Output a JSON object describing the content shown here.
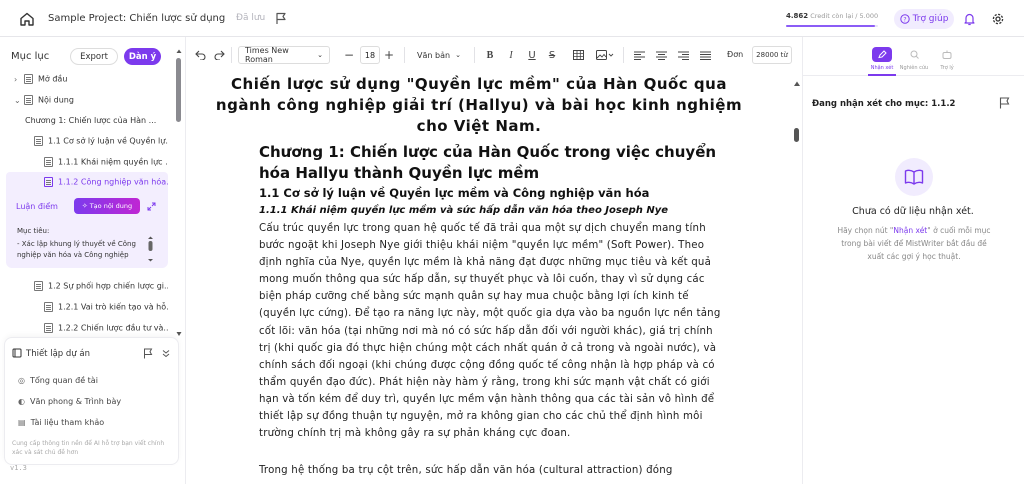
{
  "header": {
    "project_title": "Sample Project: Chiến lược sử dụng \"Qu...",
    "saved_status": "Đã lưu",
    "credit_value": "4.862",
    "credit_label": "Credit còn lại",
    "credit_total": "5.000",
    "credit_fraction": 0.9724,
    "help_label": "Trợ giúp"
  },
  "sidebar": {
    "title": "Mục lục",
    "export_label": "Export",
    "outline_label": "Dàn ý",
    "items": [
      {
        "label": "Mở đầu",
        "expanded": false
      },
      {
        "label": "Nội dung",
        "expanded": true
      },
      {
        "label": "Chương 1: Chiến lược của Hàn ..."
      },
      {
        "label": "1.1 Cơ sở lý luận về Quyền lự..."
      },
      {
        "label": "1.1.1 Khái niệm quyền lực ..."
      },
      {
        "label": "1.1.2 Công nghiệp văn hóa..."
      },
      {
        "label": "1.2 Sự phối hợp chiến lược gi..."
      },
      {
        "label": "1.2.1 Vai trò kiến tạo và hỗ..."
      },
      {
        "label": "1.2.2 Chiến lược đầu tư và..."
      }
    ],
    "point_label": "Luận điểm",
    "generate_label": "Tạo nội dung",
    "goal_title": "Mục tiêu:",
    "goal_text": "- Xác lập khung lý thuyết về Công nghiệp văn hóa và Công nghiệp",
    "settings_title": "Thiết lập dự án",
    "settings_items": [
      "Tổng quan đề tài",
      "Văn phong & Trình bày",
      "Tài liệu tham khảo"
    ],
    "settings_note": "Cung cấp thông tin nền để AI hỗ trợ bạn viết chính xác và sát chủ đề hơn",
    "version": "v1.3"
  },
  "toolbar": {
    "font": "Times New Roman",
    "font_size": "18",
    "style": "Văn bản",
    "words_label": "Đơn",
    "words_value": "28000 từ"
  },
  "document": {
    "title": "Chiến lược sử dụng \"Quyền lực mềm\" của Hàn Quốc qua ngành công nghiệp giải trí (Hallyu) và bài học kinh nghiệm cho Việt Nam.",
    "chapter": "Chương 1: Chiến lược của Hàn Quốc trong việc chuyển hóa Hallyu thành Quyền lực mềm",
    "section": "1.1 Cơ sở lý luận về Quyền lực mềm và Công nghiệp văn hóa",
    "subsection": "1.1.1 Khái niệm quyền lực mềm và sức hấp dẫn văn hóa theo Joseph Nye",
    "para1": "Cấu trúc quyền lực trong quan hệ quốc tế đã trải qua một sự dịch chuyển mang tính bước ngoặt khi Joseph Nye giới thiệu khái niệm \"quyền lực mềm\" (Soft Power). Theo định nghĩa của Nye, quyền lực mềm là khả năng đạt được những mục tiêu và kết quả mong muốn thông qua sức hấp dẫn, sự thuyết phục và lôi cuốn, thay vì sử dụng các biện pháp cưỡng chế bằng sức mạnh quân sự hay mua chuộc bằng lợi ích kinh tế (quyền lực cứng). Để tạo ra năng lực này, một quốc gia dựa vào ba nguồn lực nền tảng cốt lõi: văn hóa (tại những nơi mà nó có sức hấp dẫn đối với người khác), giá trị chính trị (khi quốc gia đó thực hiện chúng một cách nhất quán ở cả trong và ngoài nước), và chính sách đối ngoại (khi chúng được cộng đồng quốc tế công nhận là hợp pháp và có thẩm quyền đạo đức). Phát hiện này hàm ý rằng, trong khi sức mạnh vật chất có giới hạn và tốn kém để duy trì, quyền lực mềm vận hành thông qua các tài sản vô hình để thiết lập sự đồng thuận tự nguyện, mở ra không gian cho các chủ thể định hình môi trường chính trị mà không gây ra sự phản kháng cực đoan.",
    "para2": "Trong hệ thống ba trụ cột trên, sức hấp dẫn văn hóa (cultural attraction) đóng"
  },
  "right_panel": {
    "tabs": [
      "Nhận xét",
      "Nghiên cứu",
      "Trợ lý"
    ],
    "comment_title": "Đang nhận xét cho mục: 1.1.2",
    "empty_title": "Chưa có dữ liệu nhận xét.",
    "empty_desc_before": "Hãy chọn nút \"",
    "empty_desc_link": "Nhận xét",
    "empty_desc_after": "\" ở cuối mỗi mục trong bài viết để MistWriter bắt đầu đề xuất các gợi ý học thuật."
  },
  "colors": {
    "accent": "#7c3aed",
    "accent_light": "#f3eefe"
  }
}
